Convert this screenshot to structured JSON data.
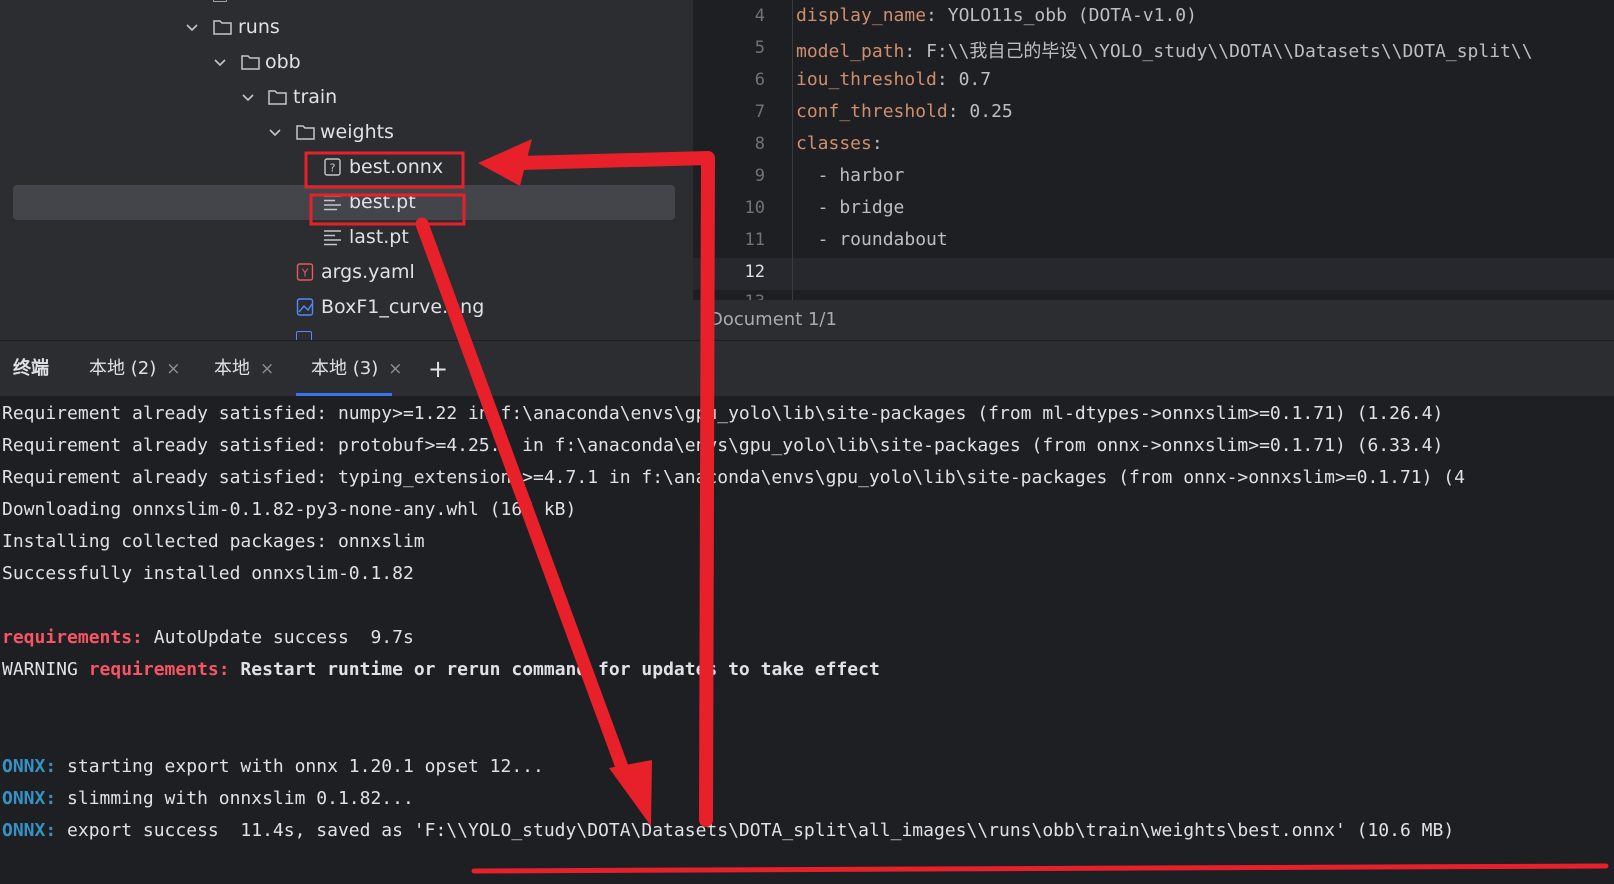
{
  "tree": {
    "items": [
      {
        "label": "runs",
        "type": "folder"
      },
      {
        "label": "obb",
        "type": "folder"
      },
      {
        "label": "train",
        "type": "folder"
      },
      {
        "label": "weights",
        "type": "folder"
      },
      {
        "label": "best.onnx",
        "type": "unknown-file"
      },
      {
        "label": "best.pt",
        "type": "text-file"
      },
      {
        "label": "last.pt",
        "type": "text-file"
      },
      {
        "label": "args.yaml",
        "type": "yaml-file"
      },
      {
        "label": "BoxF1_curve.png",
        "type": "image-file"
      }
    ]
  },
  "editor": {
    "line_numbers": [
      "4",
      "5",
      "6",
      "7",
      "8",
      "9",
      "10",
      "11",
      "12"
    ],
    "lines": [
      {
        "key": "display_name",
        "sep": ": ",
        "value": "YOLO11s_obb (DOTA-v1.0)"
      },
      {
        "key": "model_path",
        "sep": ": ",
        "value": "F:\\\\我自己的毕设\\\\YOLO_study\\\\DOTA\\\\Datasets\\\\DOTA_split\\\\"
      },
      {
        "key": "iou_threshold",
        "sep": ": ",
        "value": "0.7"
      },
      {
        "key": "conf_threshold",
        "sep": ": ",
        "value": "0.25"
      },
      {
        "key": "classes",
        "sep": ":",
        "value": ""
      },
      {
        "key": "",
        "sep": "",
        "value": "  - harbor"
      },
      {
        "key": "",
        "sep": "",
        "value": "  - bridge"
      },
      {
        "key": "",
        "sep": "",
        "value": "  - roundabout"
      },
      {
        "key": "",
        "sep": "",
        "value": ""
      }
    ],
    "status": "Document 1/1"
  },
  "terminal_tabs": {
    "title": "终端",
    "tabs": [
      {
        "label": "本地 (2)"
      },
      {
        "label": "本地"
      },
      {
        "label": "本地 (3)"
      }
    ],
    "close_glyph": "×",
    "add_glyph": "+",
    "more_glyph": "⌄"
  },
  "terminal": {
    "lines": [
      "Requirement already satisfied: numpy>=1.22 in f:\\anaconda\\envs\\gpu_yolo\\lib\\site-packages (from ml-dtypes->onnxslim>=0.1.71) (1.26.4)",
      "Requirement already satisfied: protobuf>=4.25.1 in f:\\anaconda\\envs\\gpu_yolo\\lib\\site-packages (from onnx->onnxslim>=0.1.71) (6.33.4)",
      "Requirement already satisfied: typing_extensions>=4.7.1 in f:\\anaconda\\envs\\gpu_yolo\\lib\\site-packages (from onnx->onnxslim>=0.1.71) (4",
      "Downloading onnxslim-0.1.82-py3-none-any.whl (167 kB)",
      "Installing collected packages: onnxslim",
      "Successfully installed onnxslim-0.1.82"
    ],
    "req_prefix": "requirements:",
    "req_text": " AutoUpdate success  9.7s",
    "warn_prefix": "WARNING ",
    "warn_req": "requirements:",
    "warn_text": " Restart runtime or rerun command for updates to take effect",
    "onnx_prefix": "ONNX:",
    "onnx_lines": [
      " starting export with onnx 1.20.1 opset 12...",
      " slimming with onnxslim 0.1.82...",
      " export success  11.4s, saved as 'F:\\\\YOLO_study\\DOTA\\Datasets\\DOTA_split\\all_images\\\\runs\\obb\\train\\weights\\best.onnx' (10.6 MB)"
    ]
  },
  "colors": {
    "annotation_red": "#e8202a",
    "keyword": "#cf8e6d",
    "onnx_blue": "#3592c4",
    "requirements_red": "#f75464"
  }
}
